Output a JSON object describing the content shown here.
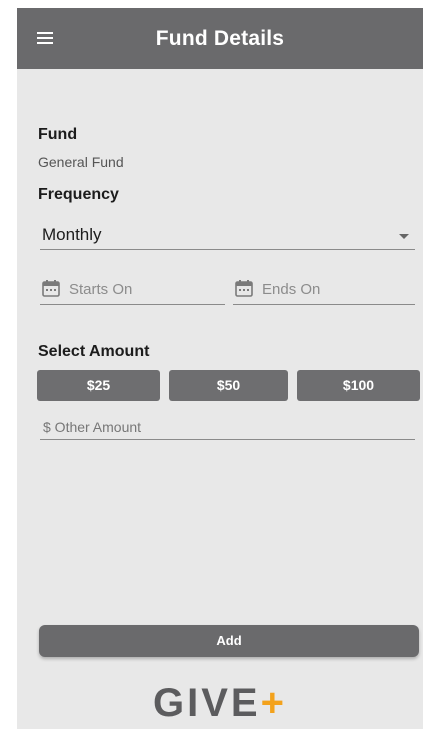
{
  "header": {
    "title": "Fund Details",
    "menu_icon": "hamburger-menu-icon"
  },
  "fund": {
    "label": "Fund",
    "value": "General Fund"
  },
  "frequency": {
    "label": "Frequency",
    "selected": "Monthly"
  },
  "dates": {
    "starts_placeholder": "Starts On",
    "ends_placeholder": "Ends On",
    "icon": "calendar-icon"
  },
  "amount": {
    "label": "Select Amount",
    "options": [
      "$25",
      "$50",
      "$100"
    ],
    "other_placeholder": "$ Other Amount"
  },
  "actions": {
    "add_label": "Add"
  },
  "brand": {
    "text": "GIVE",
    "plus": "+",
    "accent_color": "#f3a21c"
  },
  "colors": {
    "bar": "#6a6a6c",
    "background": "#e8e8e8",
    "button": "#6e6e70"
  }
}
